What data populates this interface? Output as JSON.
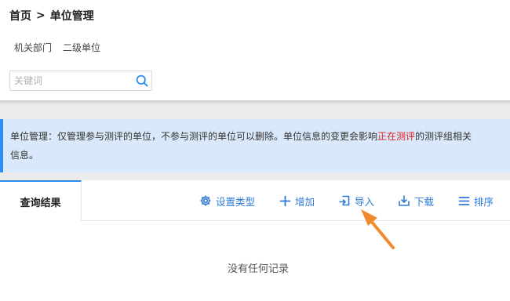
{
  "breadcrumb": {
    "home": "首页",
    "separator": ">",
    "current": "单位管理"
  },
  "subtabs": [
    {
      "label": "机关部门"
    },
    {
      "label": "二级单位"
    }
  ],
  "search": {
    "placeholder": "关键词",
    "value": ""
  },
  "notice": {
    "part1": "单位管理：仅管理参与测评的单位，不参与测评的单位可以删除。单位信息的变更会影响",
    "highlight": "正在测评",
    "part2": "的测评组相关",
    "part3": "信息。"
  },
  "results": {
    "tab_label": "查询结果",
    "actions": {
      "settings": "设置类型",
      "add": "增加",
      "import": "导入",
      "download": "下载",
      "sort": "排序"
    },
    "empty_text": "没有任何记录"
  },
  "colors": {
    "accent": "#2d8cf0",
    "link": "#2d7ad6",
    "highlight": "#e02020",
    "notice_bg": "#d9e8fa",
    "annotation_arrow": "#f08a2c"
  },
  "icons": [
    "search-icon",
    "gear-icon",
    "plus-icon",
    "import-icon",
    "download-icon",
    "sort-list-icon",
    "annotation-arrow-icon"
  ]
}
